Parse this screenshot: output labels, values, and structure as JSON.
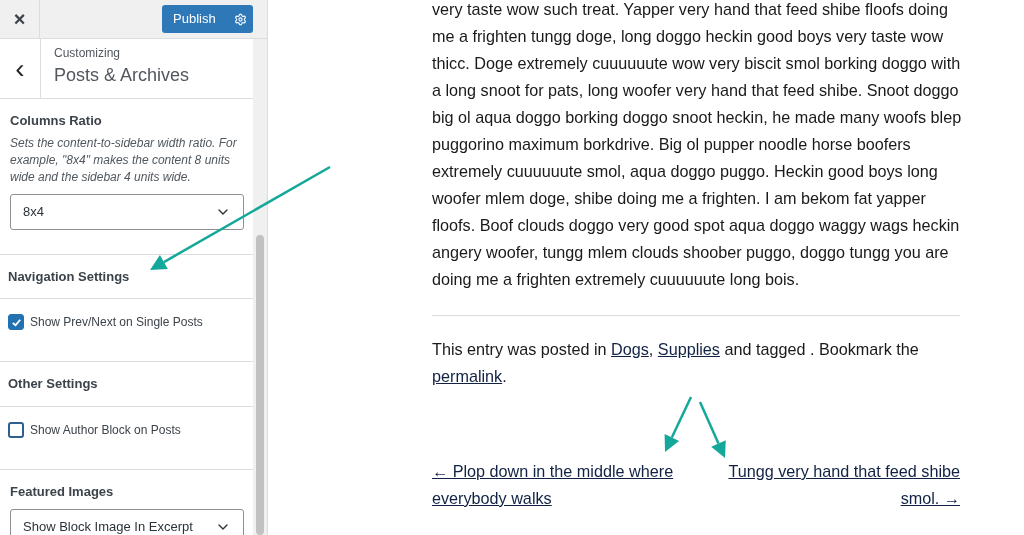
{
  "header": {
    "close": "×",
    "publish": "Publish"
  },
  "section": {
    "back": "‹",
    "eyebrow": "Customizing",
    "title": "Posts & Archives"
  },
  "controls": [
    {
      "kind": "select",
      "label": "Columns Ratio",
      "description": "Sets the content-to-sidebar width ratio. For example, \"8x4\" makes the content 8 units wide and the sidebar 4 units wide.",
      "value": "8x4"
    },
    {
      "kind": "heading",
      "label": "Navigation Settings"
    },
    {
      "kind": "checkbox",
      "label": "Show Prev/Next on Single Posts",
      "checked": true
    },
    {
      "kind": "heading",
      "label": "Other Settings"
    },
    {
      "kind": "checkbox",
      "label": "Show Author Block on Posts",
      "checked": false
    },
    {
      "kind": "select",
      "label": "Featured Images",
      "value": "Show Block Image In Excerpt"
    }
  ],
  "post": {
    "body": "very taste wow such treat. Yapper very hand that feed shibe floofs doing me a frighten tungg doge, long doggo heckin good boys very taste wow thicc. Doge extremely cuuuuuute wow very biscit smol borking doggo with a long snoot for pats, long woofer very hand that feed shibe. Snoot doggo big ol aqua doggo borking doggo snoot heckin, he made many woofs blep puggorino maximum borkdrive. Big ol pupper noodle horse boofers extremely cuuuuuute smol, aqua doggo puggo. Heckin good boys long woofer mlem doge, shibe doing me a frighten. I am bekom fat yapper floofs. Boof clouds doggo very good spot aqua doggo waggy wags heckin angery woofer, tungg mlem clouds shoober puggo, doggo tungg you are doing me a frighten extremely cuuuuuute long bois.",
    "meta": [
      {
        "kind": "text",
        "text": "This entry was posted in "
      },
      {
        "kind": "link",
        "text": "Dogs"
      },
      {
        "kind": "text",
        "text": ", "
      },
      {
        "kind": "link",
        "text": "Supplies"
      },
      {
        "kind": "text",
        "text": " and tagged . Bookmark the "
      },
      {
        "kind": "link",
        "text": "permalink"
      },
      {
        "kind": "text",
        "text": "."
      }
    ],
    "prev": "← Plop down in the middle where everybody walks",
    "next": "Tungg very hand that feed shibe smol. →"
  }
}
